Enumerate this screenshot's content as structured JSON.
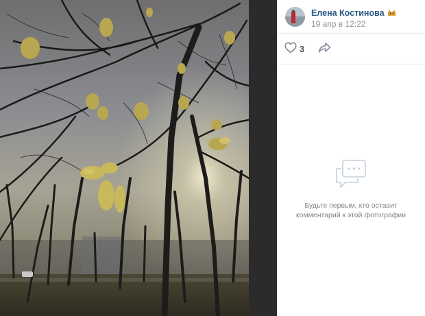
{
  "post": {
    "author": "Елена Костинова",
    "date": "19 апр в 12:22"
  },
  "actions": {
    "likes_count": "3",
    "like_icon": "heart-icon",
    "share_icon": "share-arrow-icon"
  },
  "comments": {
    "empty_line1": "Будьте первым, кто оставит",
    "empty_line2": "комментарий к этой фотографии",
    "icon": "speech-bubble-icon"
  },
  "colors": {
    "link": "#2a5885",
    "muted": "#939393",
    "page_bg": "#2b2b2b"
  }
}
